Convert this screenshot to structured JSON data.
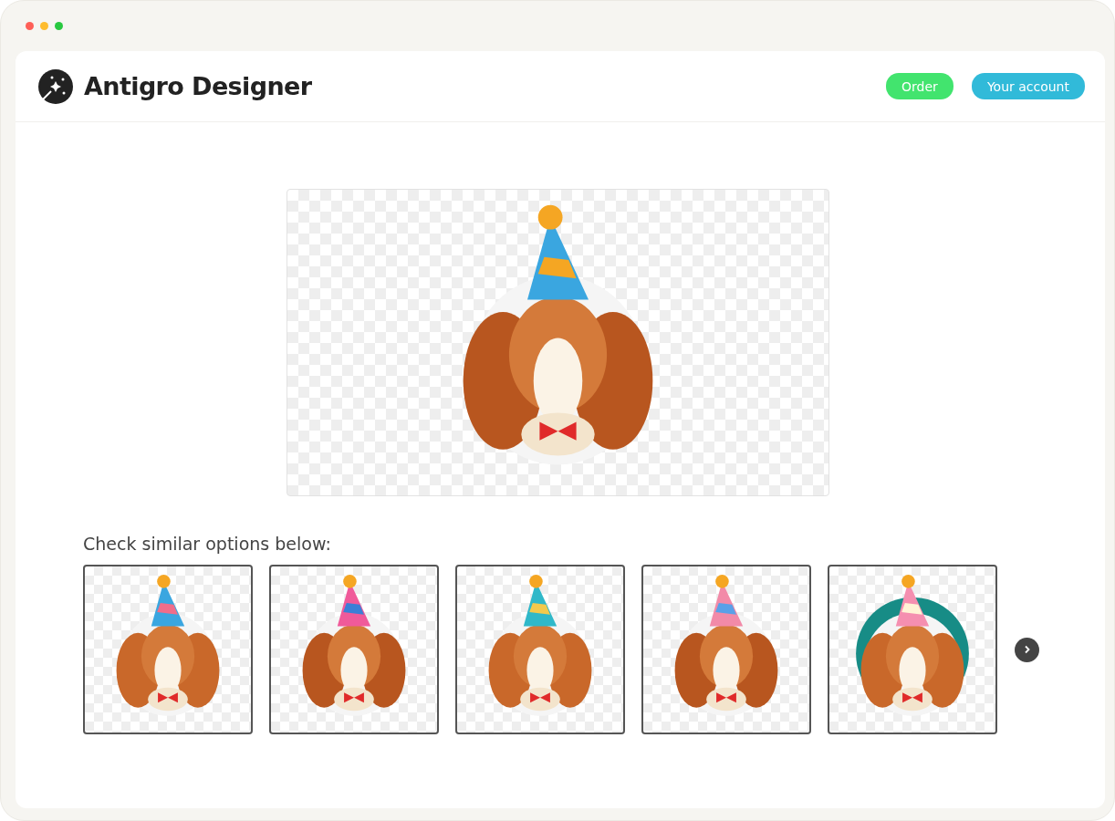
{
  "app": {
    "title": "Antigro Designer"
  },
  "header_buttons": [
    {
      "label": "Order",
      "kind": "order"
    },
    {
      "label": "Your account",
      "kind": "account"
    }
  ],
  "similar": {
    "heading": "Check similar options below:"
  }
}
